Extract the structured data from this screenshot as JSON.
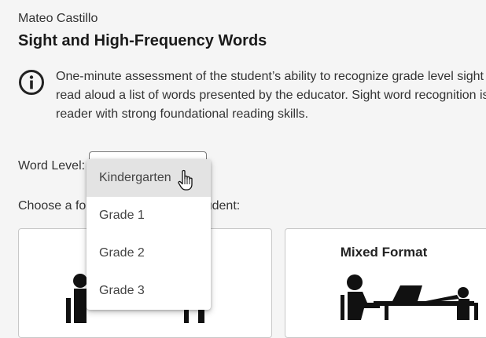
{
  "header": {
    "student_name": "Mateo Castillo",
    "title": "Sight and High-Frequency Words"
  },
  "info": {
    "icon": "info-icon",
    "lines": [
      "One-minute assessment of the student’s ability to recognize grade level sight",
      "read aloud a list of words presented by the educator. Sight word recognition is",
      "reader with strong foundational reading skills."
    ]
  },
  "word_level": {
    "label": "Word Level:",
    "selected": "",
    "options": [
      "Kindergarten",
      "Grade 1",
      "Grade 2",
      "Grade 3"
    ],
    "highlighted_option": "Kindergarten"
  },
  "format": {
    "prompt_visible_start": "Choose a fo",
    "prompt_visible_end": "tudent:",
    "cards": [
      {
        "title": ""
      },
      {
        "title": "Mixed Format"
      }
    ]
  }
}
